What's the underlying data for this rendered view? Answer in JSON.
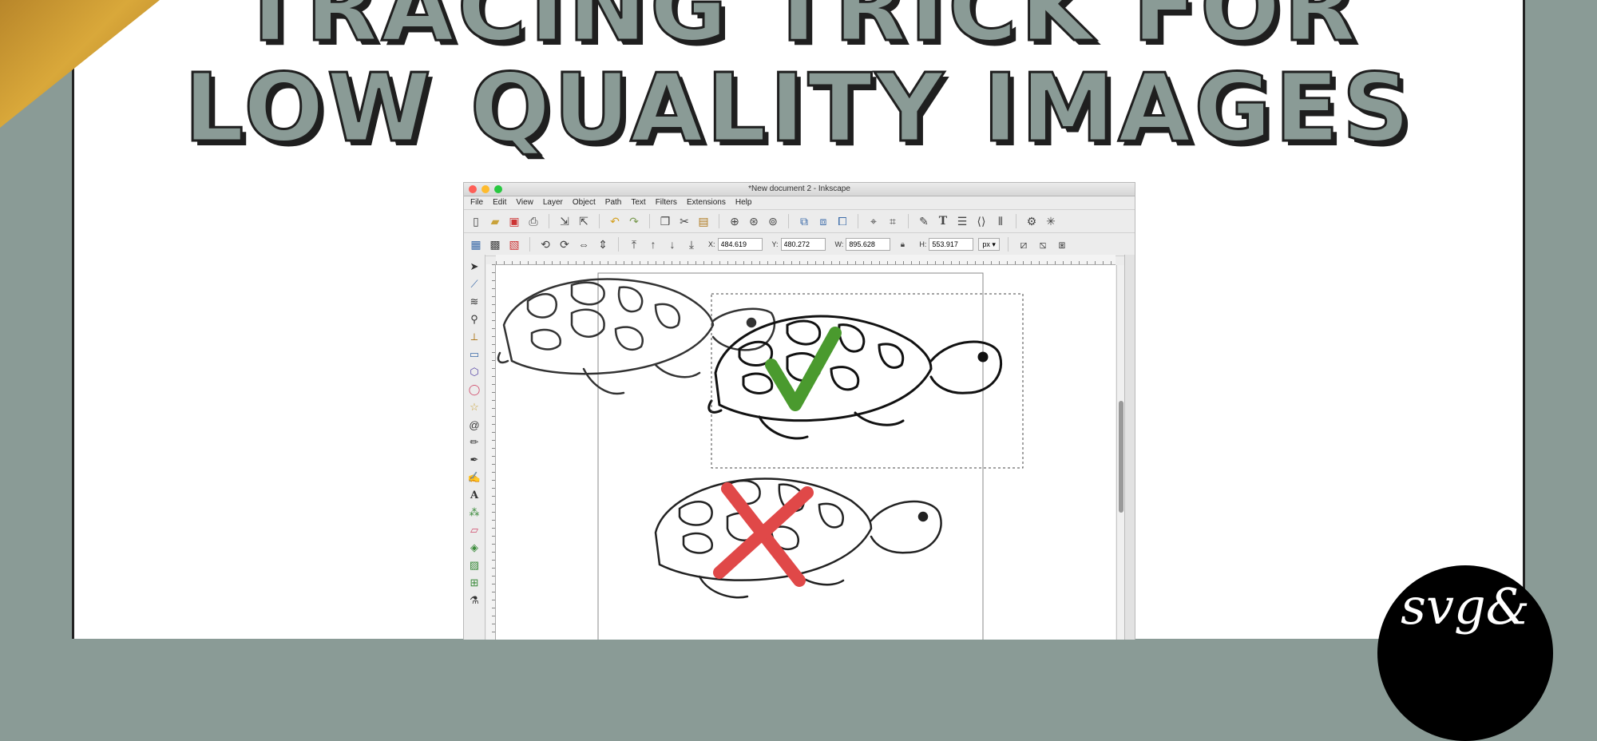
{
  "title": {
    "line1": "TRACING TRICK FOR",
    "line2": "LOW QUALITY IMAGES"
  },
  "window": {
    "title": "*New document 2 - Inkscape",
    "menu": [
      "File",
      "Edit",
      "View",
      "Layer",
      "Object",
      "Path",
      "Text",
      "Filters",
      "Extensions",
      "Help"
    ]
  },
  "toolbar": {
    "x_label": "X:",
    "x_value": "484.619",
    "y_label": "Y:",
    "y_value": "480.272",
    "w_label": "W:",
    "w_value": "895.628",
    "h_label": "H:",
    "h_value": "553.917",
    "unit": "px"
  },
  "icons": {
    "toolbar1": [
      "new-doc-icon",
      "open-icon",
      "save-icon",
      "print-icon",
      "import-icon",
      "export-icon",
      "undo-icon",
      "redo-icon",
      "duplicate-icon",
      "cut-icon",
      "paste-icon",
      "zoom-selection-icon",
      "zoom-drawing-icon",
      "zoom-page-icon",
      "group-icon",
      "ungroup-icon",
      "clone-icon",
      "node-icon",
      "transform-icon",
      "fill-stroke-icon",
      "text-tool-icon",
      "layers-icon",
      "xml-editor-icon",
      "align-icon",
      "preferences-icon",
      "doc-properties-icon"
    ],
    "toolbox": [
      "select-tool-icon",
      "node-tool-icon",
      "tweak-tool-icon",
      "zoom-tool-icon",
      "measure-tool-icon",
      "rect-tool-icon",
      "3dbox-tool-icon",
      "ellipse-tool-icon",
      "star-tool-icon",
      "spiral-tool-icon",
      "pencil-tool-icon",
      "pen-tool-icon",
      "calligraphy-tool-icon",
      "text-tool-icon",
      "spray-tool-icon",
      "eraser-tool-icon",
      "bucket-tool-icon",
      "gradient-tool-icon",
      "mesh-tool-icon",
      "dropper-tool-icon"
    ]
  },
  "marks": {
    "check_color": "#4a9a2e",
    "cross_color": "#e04848"
  },
  "colors": {
    "background": "#8a9b96",
    "title_fill": "#8a9b96",
    "title_outline": "#1f1f1f",
    "gold": "#c8962e"
  },
  "logo": {
    "text": "svg&"
  }
}
